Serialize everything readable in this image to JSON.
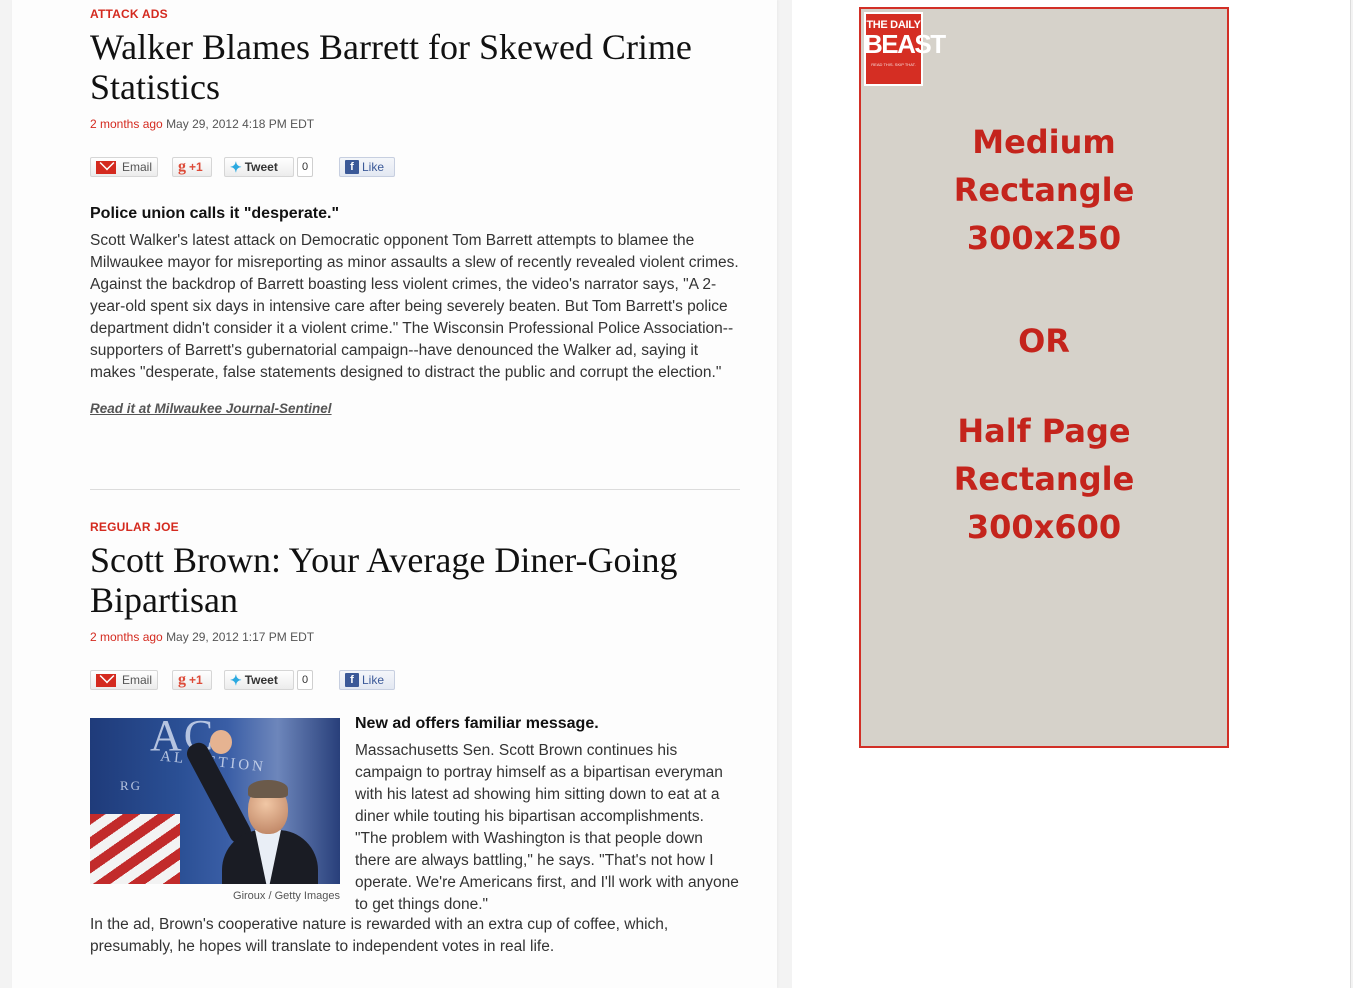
{
  "articles": [
    {
      "kicker": "ATTACK ADS",
      "headline": "Walker Blames Barrett for Skewed Crime Statistics",
      "time_ago": "2 months ago",
      "date": "May 29, 2012 4:18 PM EDT",
      "share": {
        "email": "Email",
        "gplus": "+1",
        "tweet": "Tweet",
        "tweet_count": "0",
        "like": "Like"
      },
      "deck": "Police union calls it \"desperate.\"",
      "body": "Scott Walker's latest attack on Democratic opponent Tom Barrett attempts to blamee the Milwaukee mayor for misreporting as minor assaults a slew of recently revealed violent crimes. Against the backdrop of Barrett boasting less violent crimes, the video's narrator says, \"A 2-year-old spent six days in intensive care after being severely beaten. But Tom Barrett's police department didn't consider it a violent crime.\" The Wisconsin Professional Police Association--supporters of Barrett's gubernatorial campaign--have denounced the Walker ad, saying it makes \"desperate, false statements designed to distract the public and corrupt the election.\"",
      "read_more": "Read it at Milwaukee Journal-Sentinel"
    },
    {
      "kicker": "REGULAR JOE",
      "headline": "Scott Brown: Your Average Diner-Going Bipartisan",
      "time_ago": "2 months ago",
      "date": "May 29, 2012 1:17 PM EDT",
      "share": {
        "email": "Email",
        "gplus": "+1",
        "tweet": "Tweet",
        "tweet_count": "0",
        "like": "Like"
      },
      "deck": "New ad offers familiar message.",
      "body": "Massachusetts Sen. Scott Brown continues his campaign to portray himself as a bipartisan everyman with his latest ad showing him sitting down to eat at a diner while touting his bipartisan accomplishments. \"The problem with Washington is that people down there are always battling,\" he says. \"That's not how I operate. We're Americans first, and I'll work with anyone to get things done.\"",
      "body_tail": "In the ad, Brown's cooperative nature is rewarded with an extra cup of coffee, which, presumably, he hopes will translate to independent votes in real life.",
      "photo_credit": "Giroux / Getty Images",
      "photo_banner": [
        "AC",
        "AL ACTION",
        "RG"
      ]
    }
  ],
  "ad": {
    "logo_line1": "THE DAILY",
    "logo_line2": "BEAST",
    "logo_line3": "READ THIS. SKIP THAT.",
    "line1": "Medium",
    "line2": "Rectangle",
    "line3": "300x250",
    "or": "OR",
    "line4": "Half Page",
    "line5": "Rectangle",
    "line6": "300x600",
    "colors": {
      "border": "#d22f26",
      "background": "#d6d2ca",
      "text": "#c4241c"
    }
  },
  "icons": [
    "email-icon",
    "google-plus-icon",
    "twitter-bird-icon",
    "facebook-icon"
  ]
}
